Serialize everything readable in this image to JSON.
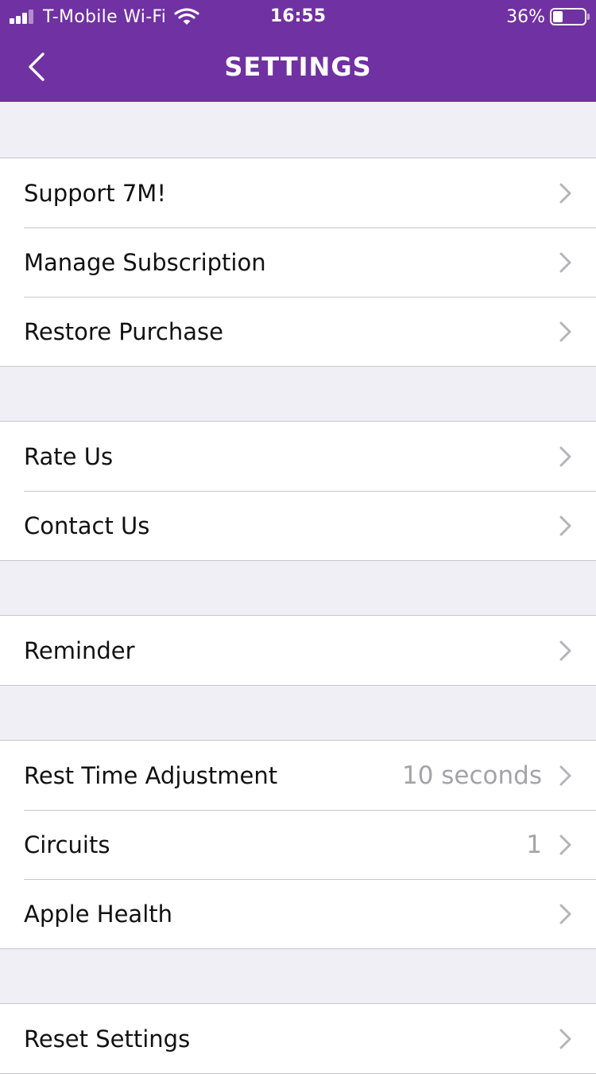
{
  "status_bar": {
    "carrier": "T-Mobile Wi-Fi",
    "time": "16:55",
    "battery_percent": "36%",
    "battery_level": 0.36,
    "signal_bars": 3,
    "signal_icon": "signal-bars-icon",
    "wifi_icon": "wifi-icon",
    "battery_icon": "battery-icon"
  },
  "header": {
    "title": "SETTINGS",
    "back_icon": "chevron-left-icon",
    "background_color": "#7031a3"
  },
  "groups": [
    {
      "items": [
        {
          "label": "Support 7M!"
        },
        {
          "label": "Manage Subscription"
        },
        {
          "label": "Restore Purchase"
        }
      ]
    },
    {
      "items": [
        {
          "label": "Rate Us"
        },
        {
          "label": "Contact Us"
        }
      ]
    },
    {
      "items": [
        {
          "label": "Reminder"
        }
      ]
    },
    {
      "items": [
        {
          "label": "Rest Time Adjustment",
          "value": "10 seconds"
        },
        {
          "label": "Circuits",
          "value": "1"
        },
        {
          "label": "Apple Health"
        }
      ]
    },
    {
      "items": [
        {
          "label": "Reset Settings"
        }
      ]
    }
  ],
  "row_icon": "chevron-right-icon"
}
